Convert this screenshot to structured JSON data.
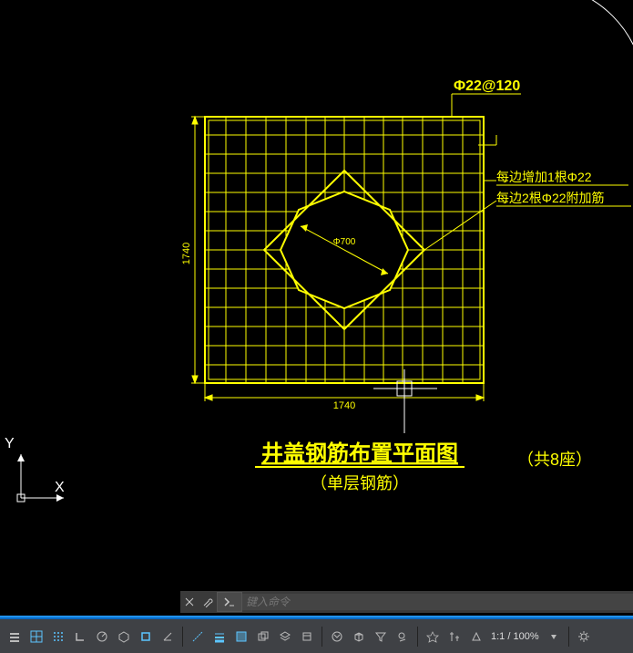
{
  "view": {
    "rebar_spec": "Φ22@120",
    "note1": "每边增加1根Φ22",
    "note2": "每边2根Φ22附加筋",
    "diameter_label": "Φ700",
    "dim_h": "1740",
    "dim_v": "1740",
    "title_main": "井盖钢筋布置平面图",
    "title_sub": "（单层钢筋）",
    "title_count": "（共8座）",
    "ucs_x": "X",
    "ucs_y": "Y"
  },
  "command": {
    "placeholder": "键入命令",
    "close_icon": "close",
    "opts_icon": "wrench",
    "prompt_icon": "chevron-right"
  },
  "status": {
    "scale_ratio": "1:1 / 100%"
  },
  "chart_data": {
    "type": "diagram",
    "description": "Rebar layout plan for manhole cover",
    "outer_width_mm": 1740,
    "outer_height_mm": 1740,
    "grid_spacing_mm": 120,
    "rebar_diameter_mm": 22,
    "opening_shape": "octagon/circle",
    "opening_diameter_mm": 700,
    "extra_bars_per_side": 1,
    "additional_bars_per_side": 2,
    "count_units": 8,
    "layer": "single"
  }
}
